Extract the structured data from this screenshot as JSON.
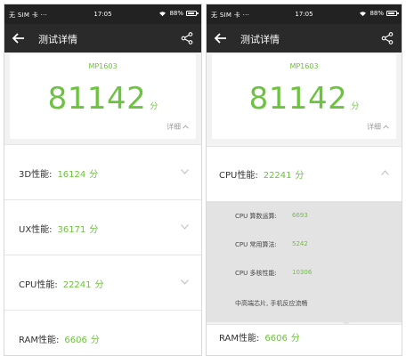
{
  "status_bar": {
    "carrier": "无 SIM 卡 ···",
    "time": "17:05",
    "battery": "88%"
  },
  "header": {
    "title": "测试详情",
    "back_icon": "back-arrow-icon",
    "share_icon": "share-icon"
  },
  "score_card": {
    "model": "MP1603",
    "score": "81142",
    "unit": "分",
    "detail_label": "详细"
  },
  "left_rows": [
    {
      "label": "3D性能:",
      "value": "16124",
      "unit": "分"
    },
    {
      "label": "UX性能:",
      "value": "36171",
      "unit": "分"
    },
    {
      "label": "CPU性能:",
      "value": "22241",
      "unit": "分"
    },
    {
      "label": "RAM性能:",
      "value": "6606",
      "unit": "分"
    }
  ],
  "right_expanded": {
    "label": "CPU性能:",
    "value": "22241",
    "unit": "分",
    "sub_items": [
      {
        "label": "CPU 算数运算:",
        "value": "6693"
      },
      {
        "label": "CPU 常用算法:",
        "value": "5242"
      },
      {
        "label": "CPU 多核性能:",
        "value": "10306"
      }
    ],
    "description": "中高端芯片, 手机反应流畅"
  },
  "right_ram_peek": {
    "label": "RAM性能:",
    "value": "6606",
    "unit": "分"
  },
  "colors": {
    "accent": "#6cc33f",
    "toolbar": "#2a2a2a",
    "statusbar": "#222222"
  }
}
